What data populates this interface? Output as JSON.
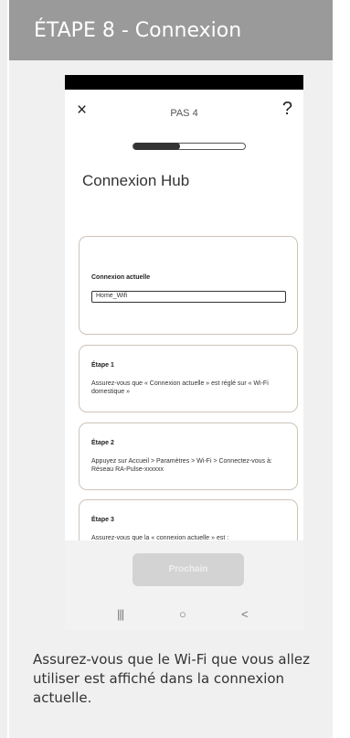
{
  "header": {
    "title": "ÉTAPE 8 - Connexion"
  },
  "phone": {
    "topbar": {
      "close": "×",
      "title": "PAS 4",
      "help": "?"
    },
    "progress": {
      "fraction": 0.42
    },
    "page_title": "Connexion Hub",
    "current_connection": {
      "label": "Connexion actuelle",
      "value": "Home_Wifi"
    },
    "steps": [
      {
        "heading": "Étape 1",
        "text": "Assurez-vous que « Connexion actuelle » est réglé sur « Wi-Fi domestique »"
      },
      {
        "heading": "Étape 2",
        "text": "Appuyez sur Accueil > Paramètres > Wi-Fi > Connectez-vous à: Réseau RA-Pulse-xxxxxx"
      },
      {
        "heading": "Étape 3",
        "text": "Assurez-vous que la « connexion actuelle » est :"
      }
    ],
    "next_button": "Prochain",
    "nav": {
      "recents": "|||",
      "home": "○",
      "back": "<"
    }
  },
  "caption": "Assurez-vous que le Wi-Fi que vous allez utiliser est affiché dans la connexion actuelle."
}
